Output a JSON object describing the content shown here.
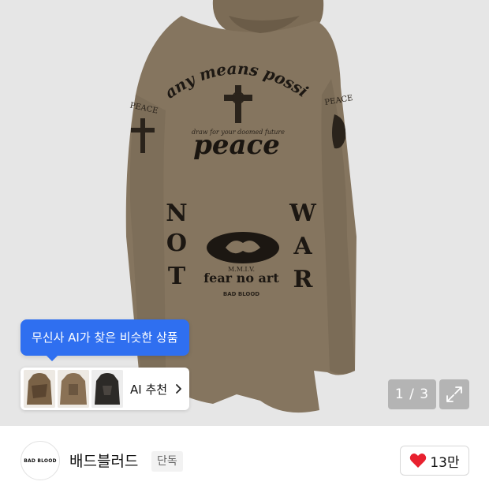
{
  "gallery": {
    "counter": "1 / 3",
    "expand_icon": "expand-icon",
    "product_print": {
      "arc_text": "any means possible",
      "small_text": "draw for your doomed future",
      "big_text": "peace",
      "left_letters": [
        "N",
        "O",
        "T"
      ],
      "right_letters": [
        "W",
        "A",
        "R"
      ],
      "emblem_caption": "M.M.I.V.",
      "emblem_text": "fear no art",
      "footer_text": "BAD BLOOD",
      "left_sleeve_text": "PEACE",
      "right_sleeve_text": "PEACE"
    }
  },
  "ai_similar": {
    "tooltip": "무신사 AI가 찾은 비슷한 상품",
    "button_label": "AI 추천",
    "chevron_icon": "chevron-right-icon"
  },
  "brand": {
    "logo_text": "BAD BLOOD",
    "name": "배드블러드",
    "tag": "단독"
  },
  "like": {
    "icon": "heart-icon",
    "count": "13만",
    "color": "#e8212f"
  },
  "colors": {
    "accent": "#2f6ff0",
    "garment": "#85755f"
  }
}
